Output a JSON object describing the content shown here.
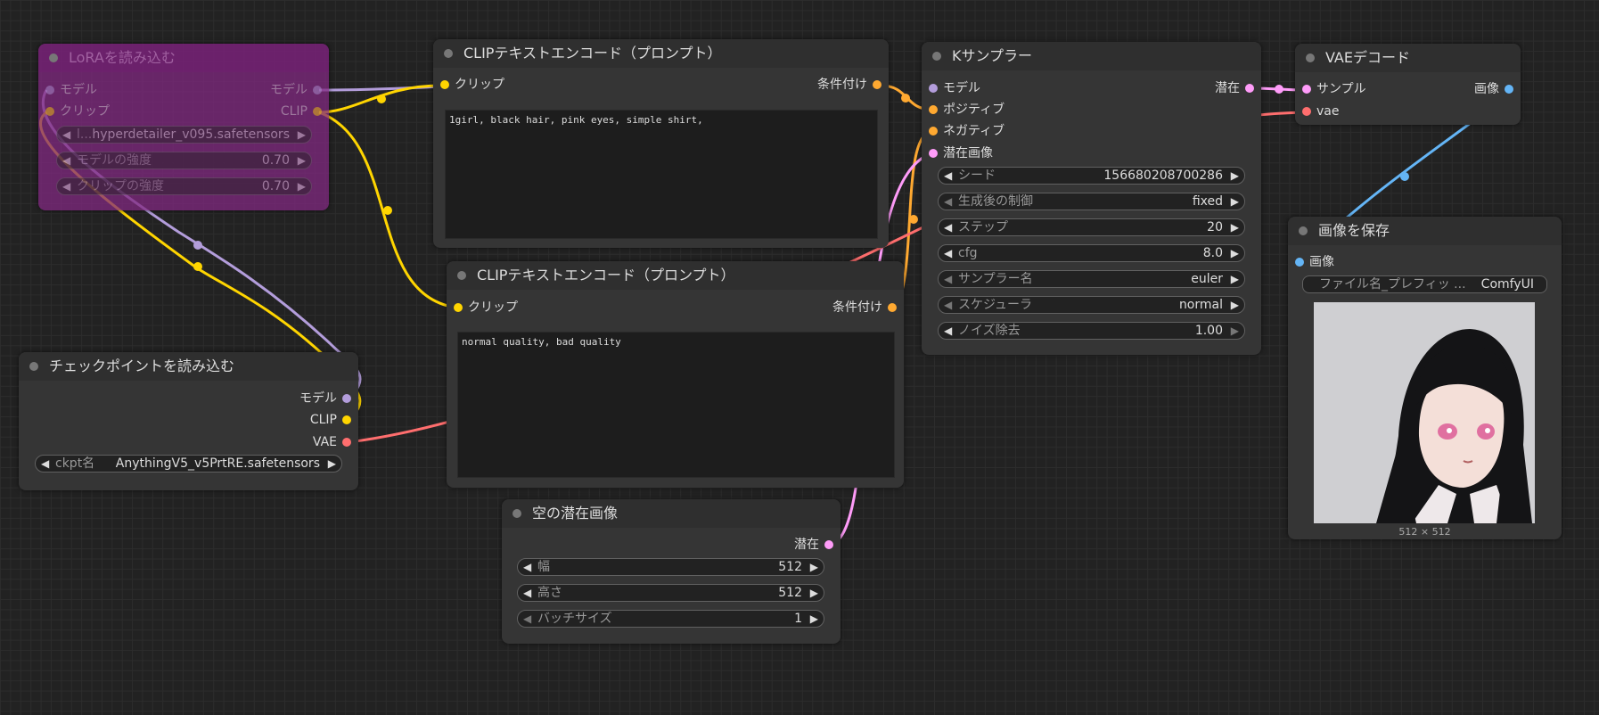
{
  "lora": {
    "title": "LoRAを読み込む",
    "in_model": "モデル",
    "in_clip": "クリップ",
    "out_model": "モデル",
    "out_clip": "CLIP",
    "lora_name_label": "l...",
    "lora_name": "hyperdetailer_v095.safetensors",
    "strength_model_label": "モデルの強度",
    "strength_model": "0.70",
    "strength_clip_label": "クリップの強度",
    "strength_clip": "0.70"
  },
  "clip_pos": {
    "title": "CLIPテキストエンコード（プロンプト）",
    "in_clip": "クリップ",
    "out_cond": "条件付け",
    "text": "1girl, black hair, pink eyes, simple shirt,"
  },
  "clip_neg": {
    "title": "CLIPテキストエンコード（プロンプト）",
    "in_clip": "クリップ",
    "out_cond": "条件付け",
    "text": "normal quality, bad quality"
  },
  "ksampler": {
    "title": "Kサンプラー",
    "in_model": "モデル",
    "in_positive": "ポジティブ",
    "in_negative": "ネガティブ",
    "in_latent": "潜在画像",
    "out_latent": "潜在",
    "seed_label": "シード",
    "seed": "156680208700286",
    "control_label": "生成後の制御",
    "control": "fixed",
    "steps_label": "ステップ",
    "steps": "20",
    "cfg_label": "cfg",
    "cfg": "8.0",
    "sampler_label": "サンプラー名",
    "sampler": "euler",
    "scheduler_label": "スケジューラ",
    "scheduler": "normal",
    "denoise_label": "ノイズ除去",
    "denoise": "1.00"
  },
  "vae_decode": {
    "title": "VAEデコード",
    "in_samples": "サンプル",
    "in_vae": "vae",
    "out_image": "画像"
  },
  "save_image": {
    "title": "画像を保存",
    "in_images": "画像",
    "prefix_label": "ファイル名_プレフィッ ...",
    "prefix": "ComfyUI",
    "size": "512 × 512"
  },
  "checkpoint": {
    "title": "チェックポイントを読み込む",
    "out_model": "モデル",
    "out_clip": "CLIP",
    "out_vae": "VAE",
    "ckpt_label": "ckpt名",
    "ckpt": "AnythingV5_v5PrtRE.safetensors"
  },
  "latent": {
    "title": "空の潜在画像",
    "out_latent": "潜在",
    "width_label": "幅",
    "width": "512",
    "height_label": "高さ",
    "height": "512",
    "batch_label": "バッチサイズ",
    "batch": "1"
  },
  "colors": {
    "model": "#b39ddb",
    "clip": "#ffd500",
    "cond": "#ffa931",
    "latent": "#ff9cf9",
    "vae": "#ff6e6e",
    "image": "#64b5f6"
  }
}
